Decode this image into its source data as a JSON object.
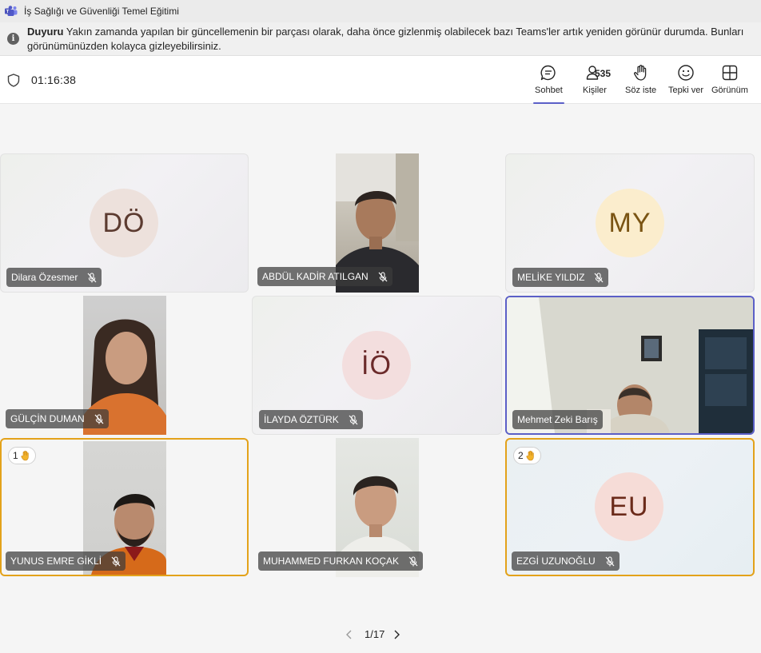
{
  "window": {
    "title": "İş Sağlığı ve Güvenliği Temel Eğitimi"
  },
  "banner": {
    "label": "Duyuru",
    "line1": "Yakın zamanda yapılan bir güncellemenin bir parçası olarak, daha önce gizlenmiş olabilecek bazı Teams'ler artık yeniden görünür durumda. Bunları",
    "line2": "görünümünüzden kolayca gizleyebilirsiniz."
  },
  "toolbar": {
    "timer": "01:16:38",
    "chat": "Sohbet",
    "people": "Kişiler",
    "people_count": "535",
    "raise": "Söz iste",
    "react": "Tepki ver",
    "view": "Görünüm"
  },
  "participants": [
    {
      "name": "Dilara Özesmer",
      "initials": "DÖ",
      "avatar_bg": "#ede1dc",
      "avatar_fg": "#5c3b30"
    },
    {
      "name": "ABDÜL KADİR ATILGAN"
    },
    {
      "name": "MELİKE YILDIZ",
      "initials": "MY",
      "avatar_bg": "#fbedcd",
      "avatar_fg": "#7a5413"
    },
    {
      "name": "GÜLÇİN DUMAN"
    },
    {
      "name": "İLAYDA ÖZTÜRK",
      "initials": "İÖ",
      "avatar_bg": "#f3dede",
      "avatar_fg": "#6b2b2b"
    },
    {
      "name": "Mehmet Zeki Barış"
    },
    {
      "name": "YUNUS EMRE GİKLİ",
      "hand_order": "1"
    },
    {
      "name": "MUHAMMED FURKAN KOÇAK"
    },
    {
      "name": "EZGİ UZUNOĞLU",
      "initials": "EU",
      "avatar_bg": "#f6dcd7",
      "avatar_fg": "#6b2a1a",
      "hand_order": "2"
    }
  ],
  "pager": {
    "label": "1/17"
  },
  "colors": {
    "accent": "#5b5fc7",
    "hand_highlight": "#e3a21a"
  }
}
